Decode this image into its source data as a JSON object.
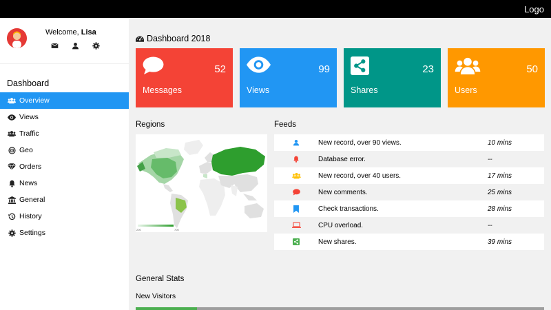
{
  "topbar": {
    "logo": "Logo"
  },
  "user": {
    "welcome_prefix": "Welcome, ",
    "name": "Lisa"
  },
  "sidebar": {
    "title": "Dashboard",
    "items": [
      {
        "label": "Overview",
        "icon": "users-icon",
        "active": true
      },
      {
        "label": "Views",
        "icon": "eye-icon"
      },
      {
        "label": "Traffic",
        "icon": "users-icon"
      },
      {
        "label": "Geo",
        "icon": "bullseye-icon"
      },
      {
        "label": "Orders",
        "icon": "diamond-icon"
      },
      {
        "label": "News",
        "icon": "bell-icon"
      },
      {
        "label": "General",
        "icon": "bank-icon"
      },
      {
        "label": "History",
        "icon": "history-icon"
      },
      {
        "label": "Settings",
        "icon": "gear-icon"
      }
    ]
  },
  "dashboard": {
    "title": "Dashboard 2018"
  },
  "cards": [
    {
      "label": "Messages",
      "value": "52",
      "icon": "comment-icon",
      "color": "#f44336"
    },
    {
      "label": "Views",
      "value": "99",
      "icon": "eye-icon",
      "color": "#2196f3"
    },
    {
      "label": "Shares",
      "value": "23",
      "icon": "share-icon",
      "color": "#009688"
    },
    {
      "label": "Users",
      "value": "50",
      "icon": "users-icon",
      "color": "#ff9800"
    }
  ],
  "regions": {
    "title": "Regions",
    "legend_min": "200",
    "legend_max": "700"
  },
  "feeds": {
    "title": "Feeds",
    "items": [
      {
        "icon": "user-icon",
        "icon_color": "#2196f3",
        "text": "New record, over 90 views.",
        "time": "10 mins"
      },
      {
        "icon": "bell-icon",
        "icon_color": "#f44336",
        "text": "Database error.",
        "time": "--"
      },
      {
        "icon": "users-icon",
        "icon_color": "#ffc107",
        "text": "New record, over 40 users.",
        "time": "17 mins"
      },
      {
        "icon": "comment-icon",
        "icon_color": "#f44336",
        "text": "New comments.",
        "time": "25 mins"
      },
      {
        "icon": "bookmark-icon",
        "icon_color": "#2196f3",
        "text": "Check transactions.",
        "time": "28 mins"
      },
      {
        "icon": "laptop-icon",
        "icon_color": "#f44336",
        "text": "CPU overload.",
        "time": "--"
      },
      {
        "icon": "share-icon",
        "icon_color": "#4caf50",
        "text": "New shares.",
        "time": "39 mins"
      }
    ]
  },
  "general_stats": {
    "title": "General Stats",
    "new_visitors_label": "New Visitors",
    "new_visitors_fraction": 0.15
  }
}
